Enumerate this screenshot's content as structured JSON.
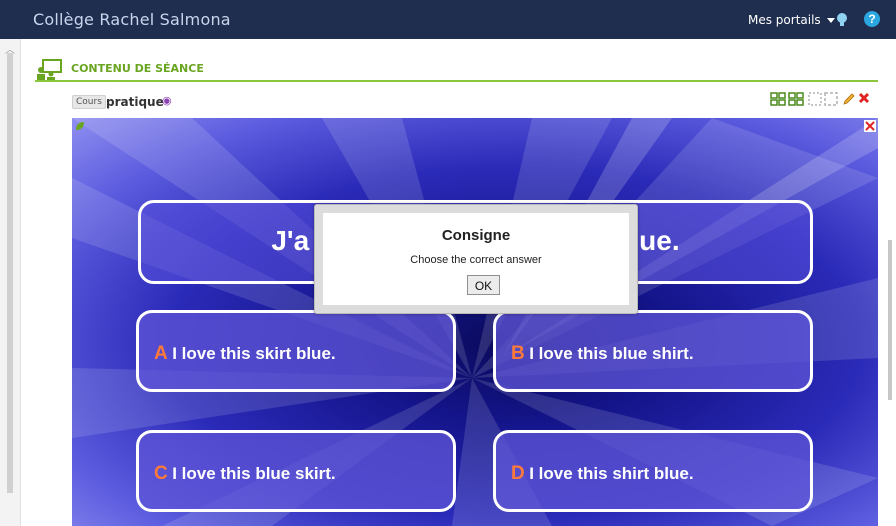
{
  "header": {
    "school_name": "Collège Rachel Salmona",
    "portals_label": "Mes portails",
    "help_label": "?"
  },
  "section": {
    "title": "CONTENU DE SÉANCE"
  },
  "course": {
    "badge": "Cours",
    "name": "pratique"
  },
  "activity": {
    "question_left": "J'a",
    "question_right": "ue.",
    "answers": [
      {
        "letter": "A",
        "text": "I love this skirt blue."
      },
      {
        "letter": "B",
        "text": "I love this blue shirt."
      },
      {
        "letter": "C",
        "text": "I love this blue skirt."
      },
      {
        "letter": "D",
        "text": "I love this shirt blue."
      }
    ]
  },
  "dialog": {
    "title": "Consigne",
    "message": "Choose the correct answer",
    "ok_label": "OK"
  },
  "colors": {
    "topbar": "#1f2d4e",
    "section_green": "#6aa521",
    "answer_letter": "#ff7a3a",
    "stage_blue": "#2a2ab8"
  },
  "icons": [
    "bulb-icon",
    "help-icon",
    "eye-icon",
    "edit-pencil-icon",
    "delete-x-icon",
    "fullscreen-icon"
  ]
}
